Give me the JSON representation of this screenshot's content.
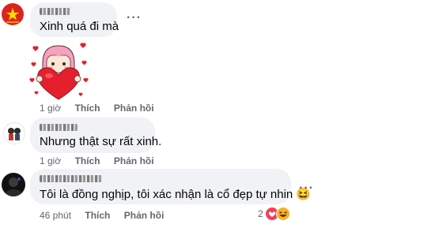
{
  "comments": [
    {
      "name": "",
      "text": "Xinh quá đi mà",
      "time": "1 giờ",
      "like": "Thích",
      "reply": "Phản hồi",
      "sticker": "heart-girl-sticker"
    },
    {
      "name": "",
      "text": "Nhưng thật sự rất xinh.",
      "time": "1 giờ",
      "like": "Thích",
      "reply": "Phản hồi"
    },
    {
      "name": "",
      "text": "Tôi là đồng nghịp, tôi xác nhận là cổ đẹp tự nhin 😆",
      "time": "46 phút",
      "like": "Thích",
      "reply": "Phản hồi",
      "reaction_count": "2"
    }
  ],
  "more_label": "···",
  "colors": {
    "heart": "#e4202f",
    "hair": "#f7a1c0",
    "flag": "#da251d",
    "star": "#ffdd00",
    "haha": "#f7b125"
  }
}
